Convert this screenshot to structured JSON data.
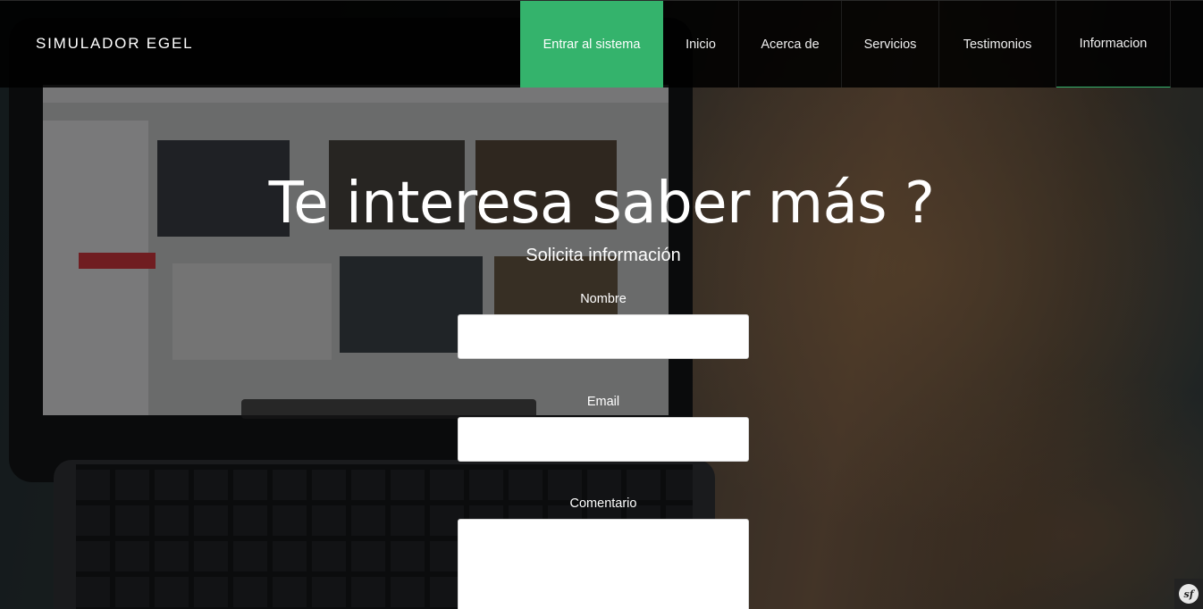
{
  "navbar": {
    "brand": "SIMULADOR EGEL",
    "items": [
      {
        "label": "Entrar al sistema"
      },
      {
        "label": "Inicio"
      },
      {
        "label": "Acerca de"
      },
      {
        "label": "Servicios"
      },
      {
        "label": "Testimonios"
      },
      {
        "label": "Informacion"
      }
    ],
    "active_item": "Informacion"
  },
  "hero": {
    "title": "Te interesa saber más ?",
    "subtitle": "Solicita información"
  },
  "form": {
    "name_label": "Nombre",
    "name_value": "",
    "email_label": "Email",
    "email_value": "",
    "comment_label": "Comentario",
    "comment_value": ""
  },
  "debug_toolbar": {
    "icon": "symfony-logo-icon",
    "glyph": "sf"
  },
  "colors": {
    "accent": "#34b36c",
    "navbar_bg": "#000000",
    "text": "#ffffff"
  }
}
